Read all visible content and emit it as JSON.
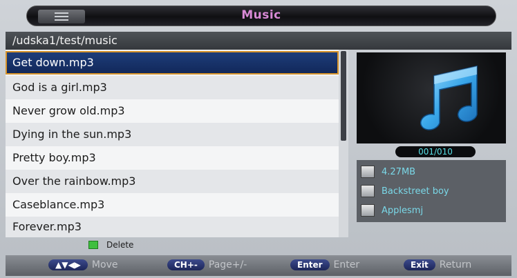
{
  "title": "Music",
  "path": "/udska1/test/music",
  "files": [
    "Get down.mp3",
    "God is a girl.mp3",
    "Never grow old.mp3",
    "Dying in the sun.mp3",
    "Pretty boy.mp3",
    "Over the rainbow.mp3",
    "Caseblance.mp3",
    "Forever.mp3"
  ],
  "selected_index": 0,
  "counter": "001/010",
  "info": {
    "size": "4.27MB",
    "artist": "Backstreet boy",
    "album": "Applesmj"
  },
  "delete_label": "Delete",
  "hints": [
    {
      "key": "▲▼◀▶",
      "label": "Move"
    },
    {
      "key": "CH+-",
      "label": "Page+/-"
    },
    {
      "key": "Enter",
      "label": "Enter"
    },
    {
      "key": "Exit",
      "label": "Return"
    }
  ],
  "colors": {
    "title": "#d98ad6",
    "selected_row": "#1e3d7a",
    "selected_border": "#d8942a",
    "info_text": "#7ad8e8",
    "counter_text": "#58e0e6",
    "delete_key": "#3fbf3f",
    "note": "#3aa7ea"
  },
  "icons": {
    "menu": "menu-icon",
    "note": "music-note-icon",
    "size": "file-size-icon",
    "artist": "artist-icon",
    "album": "album-icon"
  }
}
